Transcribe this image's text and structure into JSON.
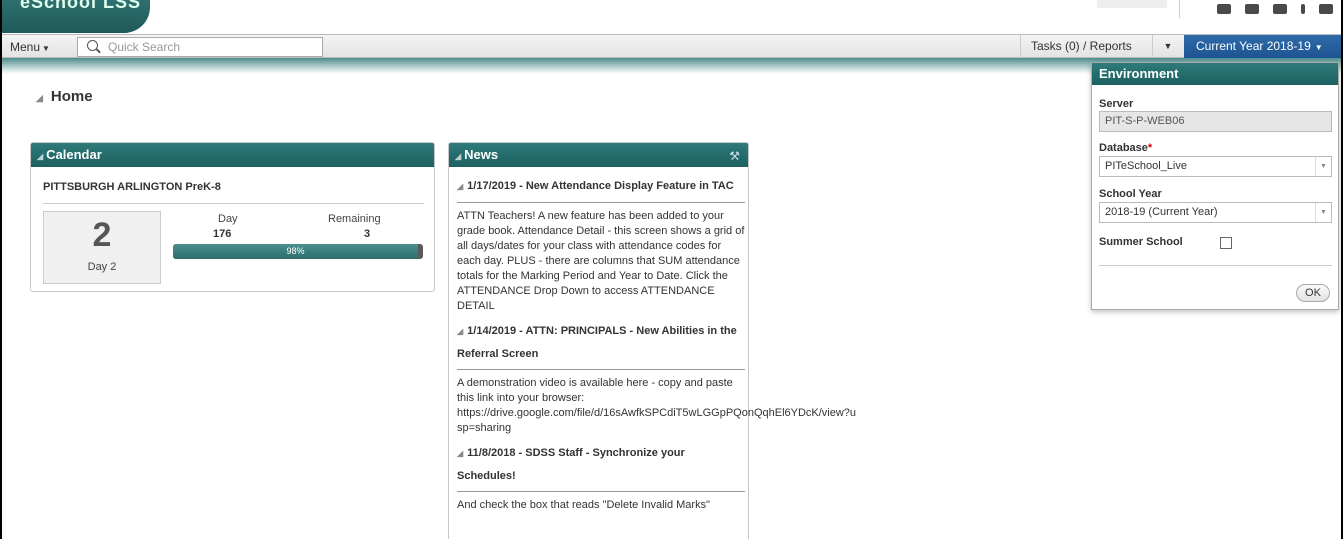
{
  "app": {
    "logo_text": "eSchool LSS"
  },
  "toolbar": {
    "menu_label": "Menu",
    "search_placeholder": "Quick Search",
    "tasks_label": "Tasks (0) / Reports",
    "year_label": "Current Year 2018-19"
  },
  "page": {
    "title": "Home"
  },
  "calendar": {
    "title": "Calendar",
    "school": "PITTSBURGH ARLINGTON PreK-8",
    "day_big": "2",
    "day_sub": "Day 2",
    "day_label": "Day",
    "day_value": "176",
    "remaining_label": "Remaining",
    "remaining_value": "3",
    "progress_text": "98%",
    "progress_fraction": 0.98
  },
  "news": {
    "title": "News",
    "items": [
      {
        "title": "1/17/2019 - New Attendance Display Feature in TAC",
        "body": "ATTN Teachers! A new feature has been added to your grade book. Attendance Detail - this screen shows a grid of all days/dates for your class with attendance codes for each day. PLUS - there are columns that SUM attendance totals for the Marking Period and Year to Date. Click the ATTENDANCE Drop Down to access ATTENDANCE DETAIL"
      },
      {
        "title": "1/14/2019 - ATTN: PRINCIPALS - New Abilities in the Referral Screen",
        "body": "A demonstration video is available here - copy and paste this link into your browser:",
        "link": "https://drive.google.com/file/d/16sAwfkSPCdiT5wLGGpPQonQqhEl6YDcK/view?usp=sharing"
      },
      {
        "title": "11/8/2018 - SDSS Staff - Synchronize your Schedules!",
        "body": "And check the box that reads \"Delete Invalid Marks\""
      }
    ]
  },
  "environment": {
    "title": "Environment",
    "server_label": "Server",
    "server_value": "PIT-S-P-WEB06",
    "database_label": "Database",
    "database_value": "PITeSchool_Live",
    "school_year_label": "School Year",
    "school_year_value": "2018-19 (Current Year)",
    "summer_school_label": "Summer School",
    "summer_school_checked": false,
    "ok_label": "OK"
  },
  "colors": {
    "teal": "#1d6060",
    "blue": "#1d5592"
  }
}
